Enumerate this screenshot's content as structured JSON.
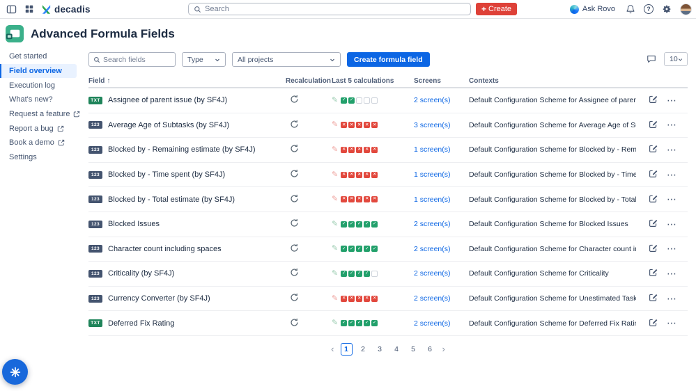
{
  "topbar": {
    "logo_text": "decadis",
    "search_placeholder": "Search",
    "create_label": "Create",
    "ask_rovo_label": "Ask Rovo"
  },
  "page": {
    "title": "Advanced Formula Fields"
  },
  "sidebar": {
    "items": [
      {
        "label": "Get started",
        "active": false,
        "external": false
      },
      {
        "label": "Field overview",
        "active": true,
        "external": false
      },
      {
        "label": "Execution log",
        "active": false,
        "external": false
      },
      {
        "label": "What's new?",
        "active": false,
        "external": false
      },
      {
        "label": "Request a feature",
        "active": false,
        "external": true
      },
      {
        "label": "Report a bug",
        "active": false,
        "external": true
      },
      {
        "label": "Book a demo",
        "active": false,
        "external": true
      },
      {
        "label": "Settings",
        "active": false,
        "external": false
      }
    ]
  },
  "toolbar": {
    "search_placeholder": "Search fields",
    "type_filter": "Type",
    "projects_filter": "All projects",
    "create_button": "Create formula field",
    "page_size": "10"
  },
  "table": {
    "columns": [
      "Field",
      "Recalculation",
      "Last 5 calculations",
      "Screens",
      "Contexts"
    ],
    "rows": [
      {
        "badge": "TXT",
        "field": "Assignee of parent issue (by SF4J)",
        "calculations": [
          "success",
          "success",
          "empty",
          "empty",
          "empty"
        ],
        "screens": "2 screen(s)",
        "context": "Default Configuration Scheme for Assignee of parent issue"
      },
      {
        "badge": "123",
        "field": "Average Age of Subtasks (by SF4J)",
        "calculations": [
          "error",
          "error",
          "error",
          "error",
          "error"
        ],
        "screens": "3 screen(s)",
        "context": "Default Configuration Scheme for Average Age of Subtasks"
      },
      {
        "badge": "123",
        "field": "Blocked by - Remaining estimate (by SF4J)",
        "calculations": [
          "error",
          "error",
          "error",
          "error",
          "error"
        ],
        "screens": "1 screen(s)",
        "context": "Default Configuration Scheme for Blocked by - Remaining esti…"
      },
      {
        "badge": "123",
        "field": "Blocked by - Time spent (by SF4J)",
        "calculations": [
          "error",
          "error",
          "error",
          "error",
          "error"
        ],
        "screens": "1 screen(s)",
        "context": "Default Configuration Scheme for Blocked by - Time spent (by …"
      },
      {
        "badge": "123",
        "field": "Blocked by - Total estimate (by SF4J)",
        "calculations": [
          "error",
          "error",
          "error",
          "error",
          "error"
        ],
        "screens": "1 screen(s)",
        "context": "Default Configuration Scheme for Blocked by - Total estimate (…"
      },
      {
        "badge": "123",
        "field": "Blocked Issues",
        "calculations": [
          "success",
          "success",
          "success",
          "success",
          "success"
        ],
        "screens": "2 screen(s)",
        "context": "Default Configuration Scheme for Blocked Issues"
      },
      {
        "badge": "123",
        "field": "Character count including spaces",
        "calculations": [
          "success",
          "success",
          "success",
          "success",
          "success"
        ],
        "screens": "2 screen(s)",
        "context": "Default Configuration Scheme for Character count including sp…"
      },
      {
        "badge": "123",
        "field": "Criticality (by SF4J)",
        "calculations": [
          "success",
          "success",
          "success",
          "success",
          "empty"
        ],
        "screens": "2 screen(s)",
        "context": "Default Configuration Scheme for Criticality"
      },
      {
        "badge": "123",
        "field": "Currency Converter (by SF4J)",
        "calculations": [
          "error",
          "error",
          "error",
          "error",
          "error"
        ],
        "screens": "2 screen(s)",
        "context": "Default Configuration Scheme for Unestimated Tasks (in an epic)"
      },
      {
        "badge": "TXT",
        "field": "Deferred Fix Rating",
        "calculations": [
          "success",
          "success",
          "success",
          "success",
          "success"
        ],
        "screens": "2 screen(s)",
        "context": "Default Configuration Scheme for Deferred Fix Rating"
      }
    ]
  },
  "pagination": {
    "prev": "‹",
    "next": "›",
    "pages": [
      "1",
      "2",
      "3",
      "4",
      "5",
      "6"
    ],
    "current": "1"
  },
  "colors": {
    "accent_blue": "#0C66E4",
    "selected_bg": "#E9F2FF",
    "success_green": "#22A06B",
    "error_red": "#E2483D",
    "create_button_red": "#DE4138",
    "badge_text_teal": "#1F845A",
    "badge_number_slate": "#44546F"
  }
}
